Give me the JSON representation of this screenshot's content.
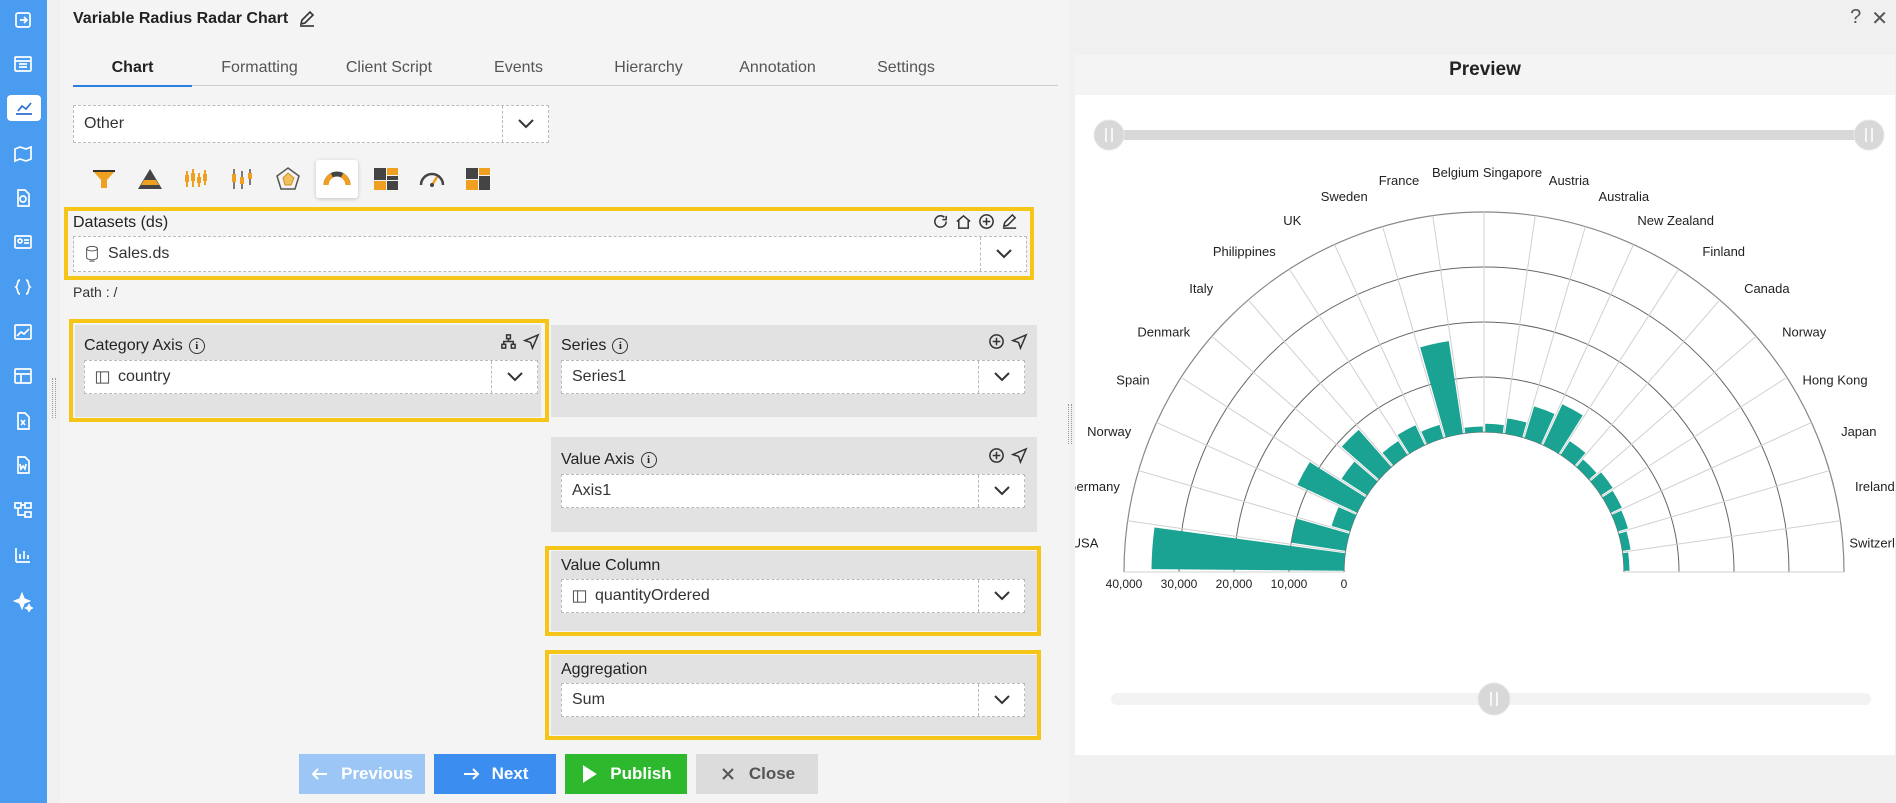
{
  "app": {
    "title": "Variable Radius Radar Chart",
    "help_label": "?",
    "close_label": "✕"
  },
  "tabs": [
    "Chart",
    "Formatting",
    "Client Script",
    "Events",
    "Hierarchy",
    "Annotation",
    "Settings"
  ],
  "chart_category": {
    "value": "Other"
  },
  "chart_types": [
    "funnel-icon",
    "pyramid-icon",
    "candlestick-icon",
    "boxplot-icon",
    "radar-icon",
    "variable-radius-radar-icon",
    "treemap-icon",
    "gauge-icon",
    "heatmap-icon"
  ],
  "datasets": {
    "label": "Datasets (ds)",
    "value": "Sales.ds",
    "path": "Path : /"
  },
  "category_axis": {
    "label": "Category Axis",
    "value": "country"
  },
  "series": {
    "label": "Series",
    "value": "Series1"
  },
  "value_axis": {
    "label": "Value Axis",
    "value": "Axis1"
  },
  "value_column": {
    "label": "Value Column",
    "value": "quantityOrdered"
  },
  "aggregation": {
    "label": "Aggregation",
    "value": "Sum"
  },
  "buttons": {
    "previous": "Previous",
    "next": "Next",
    "publish": "Publish",
    "close": "Close"
  },
  "preview": {
    "title": "Preview",
    "bar_color": "#1aa393",
    "radial_ticks": [
      "40,000",
      "30,000",
      "20,000",
      "10,000",
      "0"
    ]
  },
  "colors": {
    "rail": "#4a9cf0",
    "highlight": "#f5c518",
    "next": "#3b8ef0",
    "publish": "#2db82d",
    "previous": "#9cc6f5"
  },
  "chart_data": {
    "type": "bar",
    "title": "",
    "categories": [
      "USA",
      "Germany",
      "Norway",
      "Spain",
      "Denmark",
      "Italy",
      "Philippines",
      "UK",
      "Sweden",
      "France",
      "Belgium",
      "Singapore",
      "Austria",
      "Australia",
      "New Zealand",
      "Finland",
      "Canada",
      "Norway",
      "Hong Kong",
      "Japan",
      "Ireland",
      "Switzerland"
    ],
    "values": [
      35000,
      10000,
      3500,
      12000,
      5500,
      9000,
      3000,
      4000,
      2500,
      17000,
      1000,
      1500,
      2800,
      6000,
      8200,
      3000,
      1800,
      2500,
      2200,
      1900,
      1500,
      1000
    ],
    "radial_ticks": [
      0,
      10000,
      20000,
      30000,
      40000
    ],
    "legend": "none"
  }
}
